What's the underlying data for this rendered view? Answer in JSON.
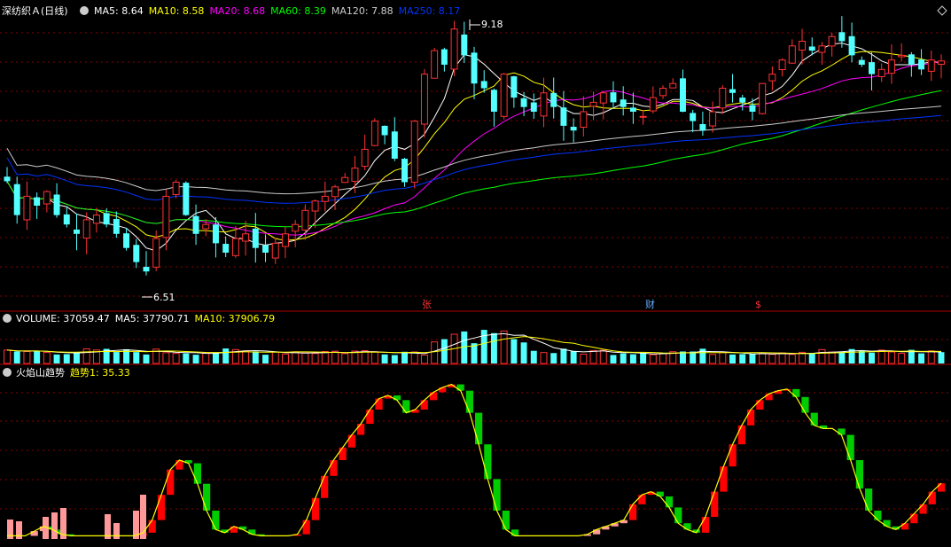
{
  "main_panel": {
    "title": "深纺织Ａ(日线)",
    "legend": [
      {
        "label": "MA5: 8.64",
        "color": "#ffffff"
      },
      {
        "label": "MA10: 8.58",
        "color": "#ffff00"
      },
      {
        "label": "MA20: 8.68",
        "color": "#ff00ff"
      },
      {
        "label": "MA60: 8.39",
        "color": "#00ff00"
      },
      {
        "label": "MA120: 7.88",
        "color": "#cccccc"
      },
      {
        "label": "MA250: 8.17",
        "color": "#0033ff"
      }
    ],
    "high_label": "9.18",
    "low_label": "6.51",
    "event_markers": [
      {
        "text": "张",
        "color": "#ff3333"
      },
      {
        "text": "财",
        "color": "#66aaff"
      },
      {
        "text": "$",
        "color": "#ff3333"
      }
    ],
    "expand_icon": "diamond-icon"
  },
  "volume_panel": {
    "legend": [
      {
        "label": "VOLUME: 37059.47",
        "color": "#ffffff"
      },
      {
        "label": "MA5: 37790.71",
        "color": "#ffffff"
      },
      {
        "label": "MA10: 37906.79",
        "color": "#ffff00"
      }
    ]
  },
  "indicator_panel": {
    "legend": [
      {
        "label": "火焰山趋势",
        "color": "#ffffff"
      },
      {
        "label": "趋势1: 35.33",
        "color": "#ffff00"
      }
    ]
  },
  "colors": {
    "up": "#ff3232",
    "down": "#54ffff",
    "grid": "#8b0000",
    "panel_border": "#b00000"
  },
  "chart_data": [
    {
      "type": "candlestick",
      "title": "深纺织Ａ(日线)",
      "y_range": [
        6.3,
        9.3
      ],
      "series": [
        {
          "name": "MA5",
          "color": "#ffffff"
        },
        {
          "name": "MA10",
          "color": "#ffff00"
        },
        {
          "name": "MA20",
          "color": "#ff00ff"
        },
        {
          "name": "MA60",
          "color": "#00ff00"
        },
        {
          "name": "MA120",
          "color": "#cccccc"
        },
        {
          "name": "MA250",
          "color": "#0033ff"
        }
      ],
      "price_path": [
        7.56,
        7.2,
        7.4,
        7.3,
        7.45,
        7.2,
        7.1,
        7.0,
        7.15,
        7.2,
        7.1,
        7.0,
        6.85,
        6.7,
        6.6,
        6.95,
        7.4,
        7.55,
        7.2,
        7.0,
        7.1,
        6.9,
        6.8,
        6.95,
        7.0,
        6.85,
        6.8,
        6.9,
        7.0,
        7.1,
        7.25,
        7.35,
        7.4,
        7.5,
        7.6,
        7.7,
        7.9,
        8.2,
        8.05,
        7.8,
        7.55,
        8.2,
        8.7,
        8.95,
        8.8,
        9.18,
        8.9,
        8.6,
        8.55,
        8.3,
        8.7,
        8.45,
        8.35,
        8.3,
        8.5,
        8.35,
        8.15,
        8.1,
        8.3,
        8.4,
        8.5,
        8.4,
        8.35,
        8.3,
        8.25,
        8.45,
        8.55,
        8.6,
        8.3,
        8.2,
        8.1,
        8.3,
        8.55,
        8.5,
        8.4,
        8.3,
        8.6,
        8.7,
        8.85,
        9.0,
        9.05,
        8.95,
        9.0,
        9.1,
        9.05,
        8.9,
        8.8,
        8.7,
        8.75,
        8.85,
        8.9,
        8.8,
        8.75,
        8.85,
        8.84
      ],
      "high": 9.18,
      "low": 6.51
    },
    {
      "type": "bar",
      "title": "VOLUME",
      "series": [
        {
          "name": "VOLUME",
          "value": 37059.47
        },
        {
          "name": "MA5",
          "value": 37790.71
        },
        {
          "name": "MA10",
          "value": 37906.79
        }
      ]
    },
    {
      "type": "bar",
      "title": "火焰山趋势",
      "series": [
        {
          "name": "趋势1",
          "value": 35.33
        }
      ],
      "y_range": [
        0,
        100
      ],
      "trend_path": [
        2,
        2,
        2,
        5,
        8,
        6,
        3,
        2,
        2,
        2,
        2,
        2,
        2,
        2,
        2,
        4,
        12,
        28,
        44,
        50,
        48,
        35,
        18,
        6,
        4,
        8,
        6,
        3,
        2,
        2,
        2,
        2,
        3,
        12,
        26,
        40,
        50,
        58,
        66,
        73,
        82,
        89,
        91,
        88,
        80,
        82,
        88,
        93,
        96,
        98,
        94,
        80,
        60,
        38,
        18,
        6,
        2,
        2,
        2,
        2,
        2,
        2,
        2,
        2,
        3,
        6,
        8,
        10,
        12,
        22,
        28,
        30,
        27,
        20,
        10,
        6,
        4,
        14,
        30,
        46,
        60,
        72,
        82,
        88,
        92,
        94,
        95,
        90,
        80,
        72,
        70,
        70,
        66,
        50,
        32,
        18,
        12,
        8,
        6,
        10,
        16,
        22,
        30,
        35.33
      ]
    }
  ]
}
